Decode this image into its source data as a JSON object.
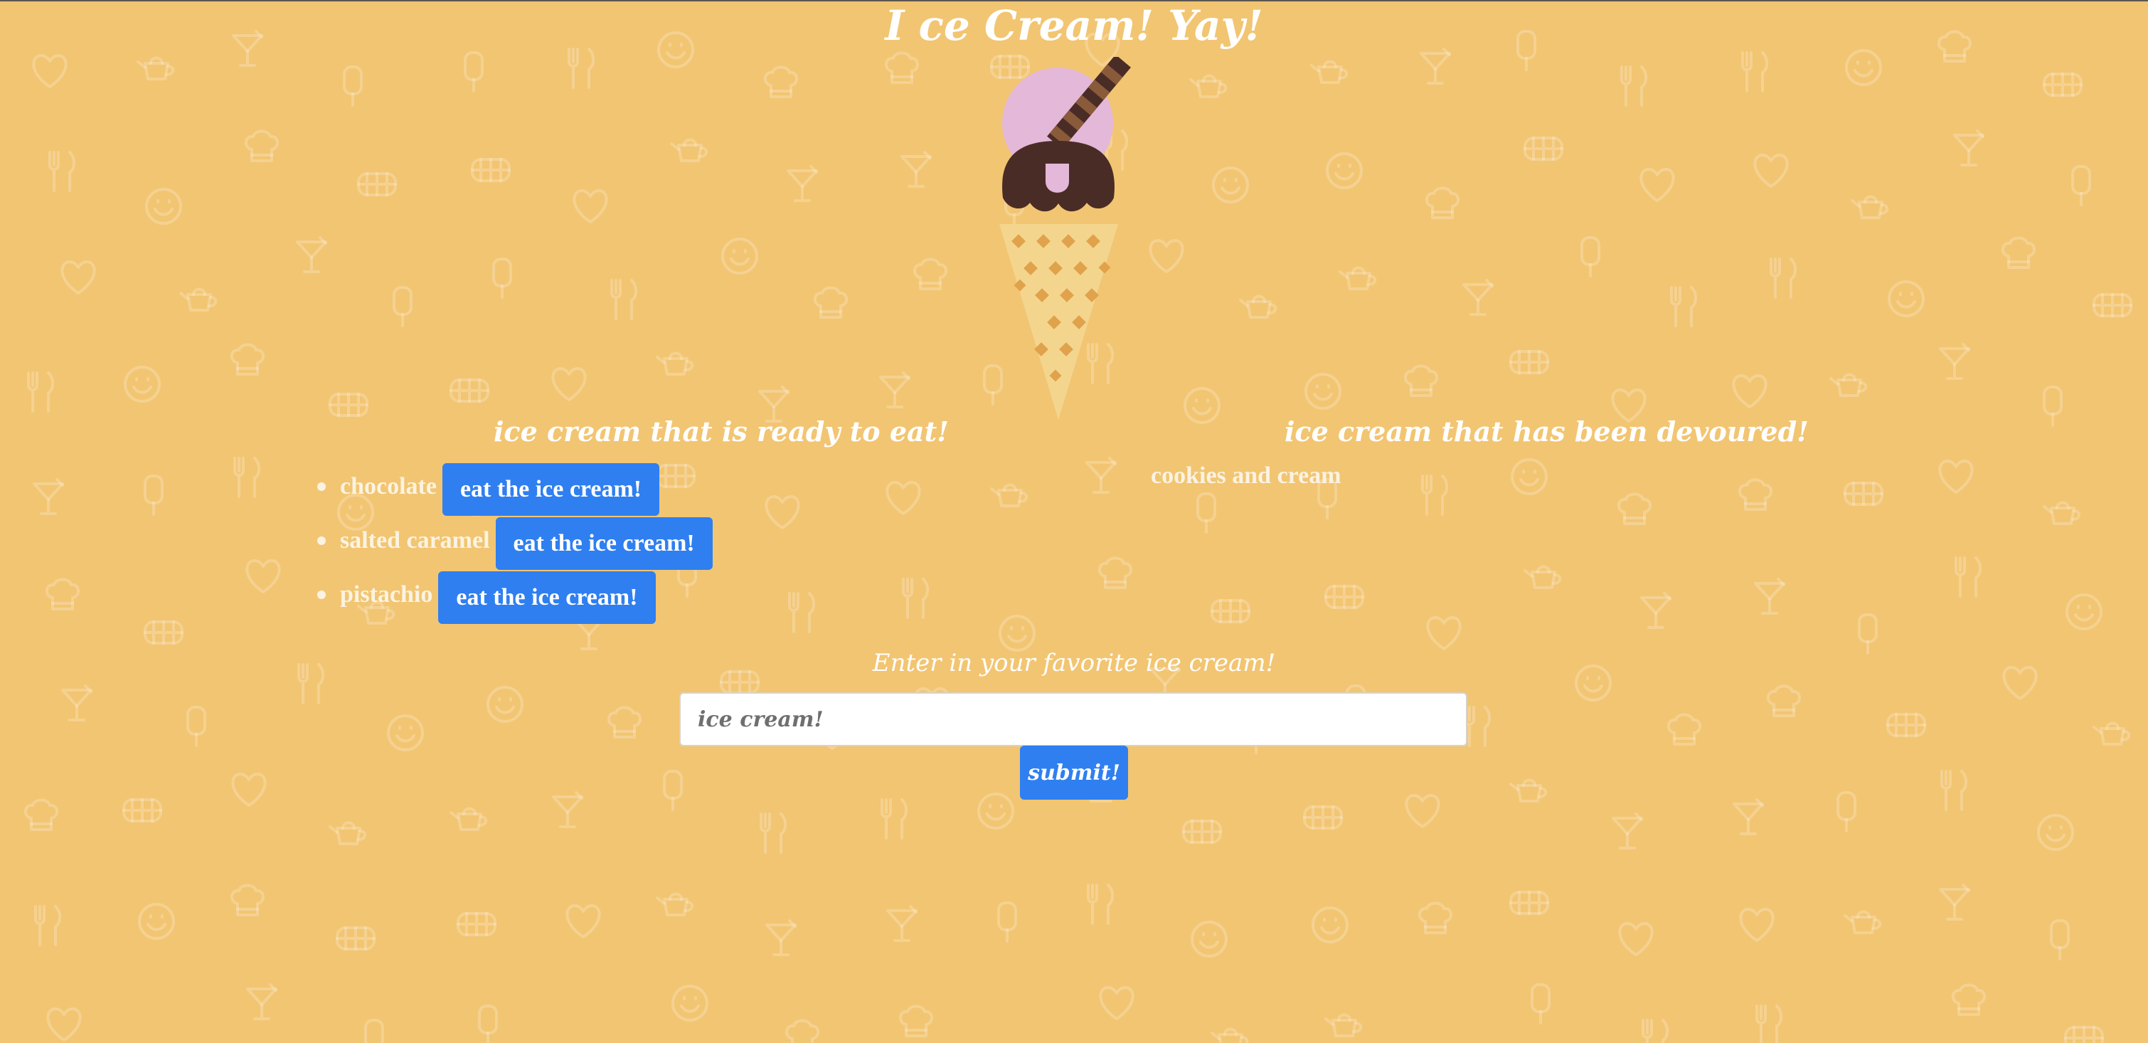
{
  "page": {
    "title": "I ce Cream! Yay!",
    "background_color": "#f2c572",
    "pattern_icons": [
      "heart-icon",
      "teapot-icon",
      "cocktail-icon",
      "popsicle-icon",
      "fork-knife-icon",
      "smiley-icon",
      "chef-hat-icon",
      "sandwich-icon"
    ]
  },
  "illustration": {
    "name": "ice-cream-cone-icon",
    "colors": {
      "top_scoop": "#e4b8d8",
      "bottom_scoop": "#4a2c26",
      "cone": "#f4d58e",
      "cone_pattern": "#e0a24b",
      "wafer_light": "#8a5b3a",
      "wafer_dark": "#4a2c26"
    }
  },
  "ready": {
    "heading": "ice cream that is ready to eat!",
    "button_label": "eat the ice cream!",
    "items": [
      {
        "flavor": "chocolate"
      },
      {
        "flavor": "salted caramel"
      },
      {
        "flavor": "pistachio"
      }
    ]
  },
  "devoured": {
    "heading": "ice cream that has been devoured!",
    "items": [
      "cookies and cream"
    ]
  },
  "form": {
    "label": "Enter in your favorite ice cream!",
    "placeholder": "ice cream!",
    "submit_label": "submit!"
  },
  "colors": {
    "button_blue": "#2f7ff0",
    "text_white": "#ffffff",
    "list_text": "#fbf3e2"
  }
}
